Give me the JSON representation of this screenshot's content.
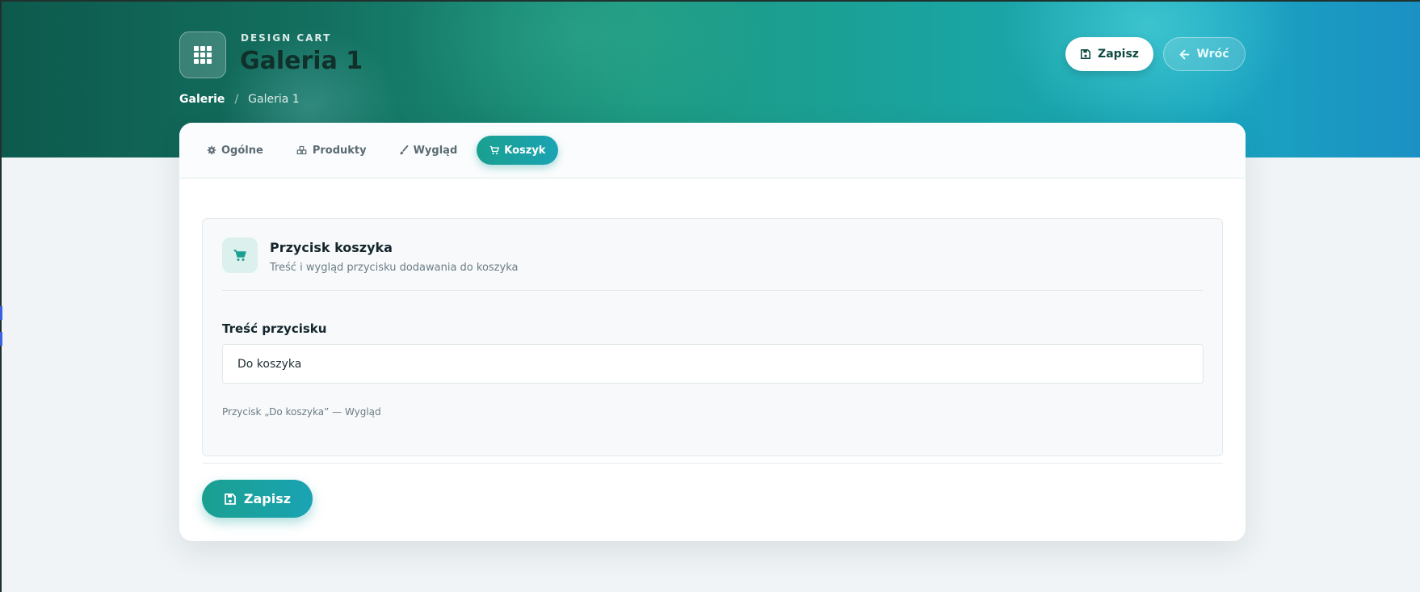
{
  "header": {
    "kicker": "DESIGN CART",
    "title": "Galeria 1",
    "save_label": "Zapisz",
    "back_label": "Wróć"
  },
  "breadcrumb": {
    "items": [
      "Galerie",
      "Galeria 1"
    ],
    "separator": "/"
  },
  "tabs": [
    {
      "label": "Ogólne",
      "icon": "gear-icon",
      "active": false
    },
    {
      "label": "Produkty",
      "icon": "cubes-icon",
      "active": false
    },
    {
      "label": "Wygląd",
      "icon": "brush-icon",
      "active": false
    },
    {
      "label": "Koszyk",
      "icon": "cart-icon",
      "active": true
    }
  ],
  "section": {
    "icon": "cart-icon",
    "title": "Przycisk koszyka",
    "subtitle": "Treść i wygląd przycisku dodawania do koszyka",
    "field_label": "Treść przycisku",
    "field_value": "Do koszyka",
    "note": "Przycisk „Do koszyka” — Wygląd"
  },
  "footer": {
    "save_label": "Zapisz"
  },
  "colors": {
    "accent": "#1aa090",
    "accent_alt": "#1aa3b3",
    "hero_dark": "#0d5a4d"
  }
}
